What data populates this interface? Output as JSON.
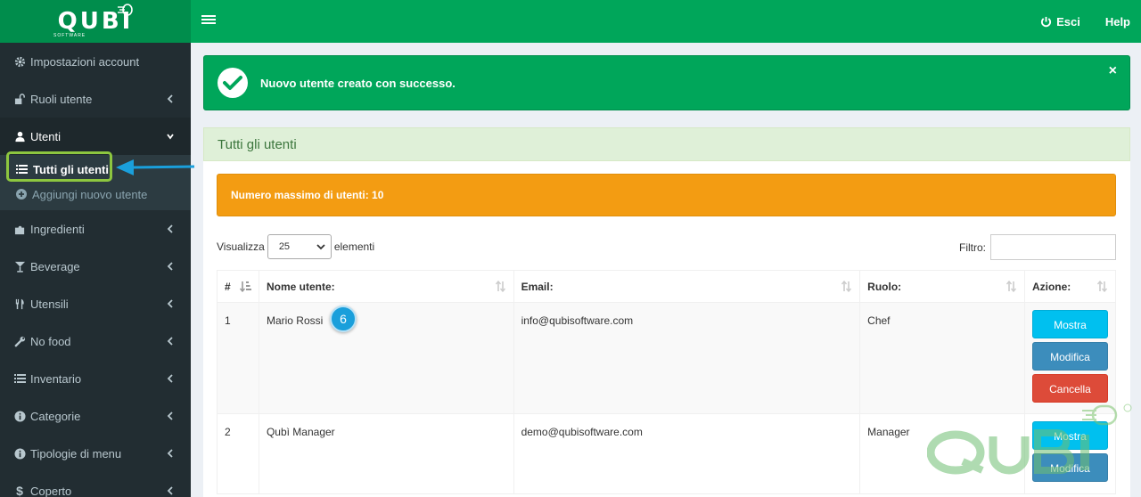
{
  "brand": {
    "name": "QUBI",
    "sub": "SOFTWARE"
  },
  "header": {
    "logout_label": "Esci",
    "help_label": "Help"
  },
  "sidebar": {
    "items": [
      {
        "label": "Impostazioni account",
        "icon": "gear-icon"
      },
      {
        "label": "Ruoli utente",
        "icon": "unlock-icon"
      },
      {
        "label": "Utenti",
        "icon": "user-icon"
      },
      {
        "label": "Ingredienti",
        "icon": "puzzle-icon"
      },
      {
        "label": "Beverage",
        "icon": "glass-icon"
      },
      {
        "label": "Utensili",
        "icon": "cutlery-icon"
      },
      {
        "label": "No food",
        "icon": "wrench-icon"
      },
      {
        "label": "Inventario",
        "icon": "list-icon"
      },
      {
        "label": "Categorie",
        "icon": "info-icon"
      },
      {
        "label": "Tipologie di menu",
        "icon": "info-icon"
      },
      {
        "label": "Coperto",
        "icon": "dollar-icon"
      }
    ],
    "submenu": [
      {
        "label": "Tutti gli utenti",
        "icon": "list-icon"
      },
      {
        "label": "Aggiungi nuovo utente",
        "icon": "plus-circle-icon"
      }
    ]
  },
  "alert": {
    "message": "Nuovo utente creato con successo.",
    "close": "×"
  },
  "box": {
    "title": "Tutti gli utenti",
    "warning": "Numero massimo di utenti: 10",
    "length_prefix": "Visualizza",
    "length_value": "25",
    "length_suffix": "elementi",
    "filter_label": "Filtro:"
  },
  "table": {
    "headers": [
      "#",
      "Nome utente:",
      "Email:",
      "Ruolo:",
      "Azione:"
    ],
    "rows": [
      {
        "id": "1",
        "name": "Mario Rossi",
        "email": "info@qubisoftware.com",
        "role": "Chef"
      },
      {
        "id": "2",
        "name": "Qubì Manager",
        "email": "demo@qubisoftware.com",
        "role": "Manager"
      }
    ],
    "actions": {
      "show": "Mostra",
      "edit": "Modifica",
      "delete": "Cancella"
    }
  },
  "step_badge": "6",
  "colors": {
    "topbar": "#00a65a",
    "sidebar": "#222d32",
    "warning": "#f39c12",
    "info": "#00c0ef",
    "primary": "#3c8dbc",
    "danger": "#dd4b39"
  }
}
